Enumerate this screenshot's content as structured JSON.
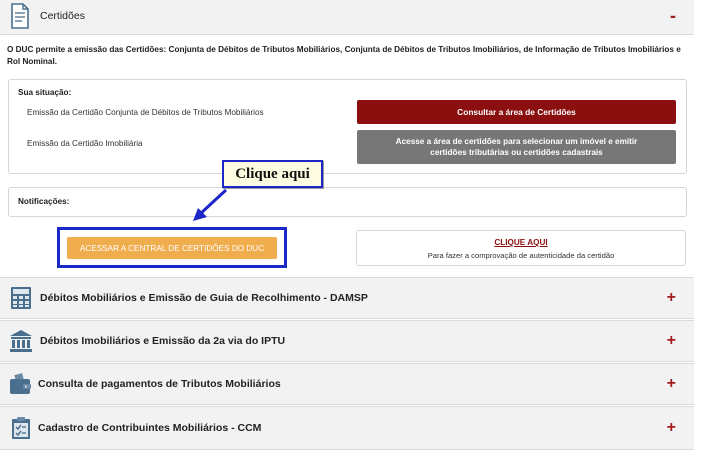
{
  "certidoes": {
    "title": "Certidões",
    "toggle": "-",
    "intro": "O DUC permite a emissão das Certidões: Conjunta de Débitos de Tributos Mobiliários, Conjunta de Débitos de Tributos Imobiliários, de Informação de Tributos Imobiliários e Rol Nominal.",
    "situacao_label": "Sua situação:",
    "rows": [
      {
        "label": "Emissão da Certidão Conjunta de Débitos de Tributos Mobiliários",
        "button": "Consultar a área de Certidões"
      },
      {
        "label": "Emissão da Certidão Imobiliária",
        "button": "Acesse a área de certidões para selecionar um imóvel e emitir certidões tributárias ou certidões cadastrais"
      }
    ],
    "notificacoes_label": "Notificações:",
    "central_button": "ACESSAR A CENTRAL DE CERTIDÕES DO DUC",
    "verify_link": "CLIQUE AQUI",
    "verify_text": "Para fazer a comprovação de autenticidade da certidão"
  },
  "callout": {
    "text": "Clique aqui"
  },
  "sections": [
    {
      "title": "Débitos Mobiliários e Emissão de Guia de Recolhimento - DAMSP",
      "toggle": "+",
      "icon": "calculator-icon"
    },
    {
      "title": "Débitos Imobiliários e Emissão da 2a via do IPTU",
      "toggle": "+",
      "icon": "bank-icon"
    },
    {
      "title": "Consulta de pagamentos de Tributos Mobiliários",
      "toggle": "+",
      "icon": "wallet-icon"
    },
    {
      "title": "Cadastro de Contribuintes Mobiliários - CCM",
      "toggle": "+",
      "icon": "clipboard-icon"
    }
  ],
  "colors": {
    "accent_red": "#8b0f0f",
    "toggle_red": "#a51c1c",
    "callout_border": "#1c27c8",
    "orange_button": "#f0ad4e",
    "gray_button": "#777777"
  }
}
